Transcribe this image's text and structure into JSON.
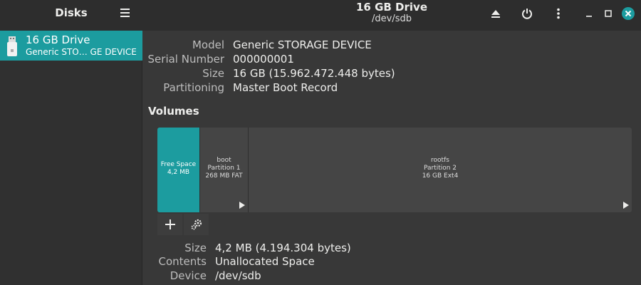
{
  "header": {
    "app_title": "Disks",
    "drive_title": "16 GB Drive",
    "drive_path": "/dev/sdb"
  },
  "sidebar": {
    "items": [
      {
        "name": "16 GB Drive",
        "subtitle": "Generic STO… GE DEVICE"
      }
    ]
  },
  "drive_info": [
    {
      "label": "Model",
      "value": "Generic STORAGE DEVICE"
    },
    {
      "label": "Serial Number",
      "value": "000000001"
    },
    {
      "label": "Size",
      "value": "16 GB (15.962.472.448 bytes)"
    },
    {
      "label": "Partitioning",
      "value": "Master Boot Record"
    }
  ],
  "volumes": {
    "title": "Volumes",
    "segments": [
      {
        "line1": "Free Space",
        "line2": "4,2 MB",
        "line3": ""
      },
      {
        "line1": "boot",
        "line2": "Partition 1",
        "line3": "268 MB FAT"
      },
      {
        "line1": "rootfs",
        "line2": "Partition 2",
        "line3": "16 GB Ext4"
      }
    ]
  },
  "selected_volume": [
    {
      "label": "Size",
      "value": "4,2 MB (4.194.304 bytes)"
    },
    {
      "label": "Contents",
      "value": "Unallocated Space"
    },
    {
      "label": "Device",
      "value": "/dev/sdb"
    }
  ],
  "colors": {
    "accent": "#1c9c9f",
    "close_button": "#1c9c9f"
  },
  "icons": {
    "menu": "hamburger-menu-icon",
    "eject": "eject-icon",
    "power": "power-icon",
    "more": "more-vertical-icon",
    "minimize": "minimize-icon",
    "maximize": "maximize-icon",
    "close": "close-icon",
    "usb": "usb-drive-icon",
    "add": "plus-icon",
    "settings": "gears-icon",
    "mount": "play-icon"
  }
}
